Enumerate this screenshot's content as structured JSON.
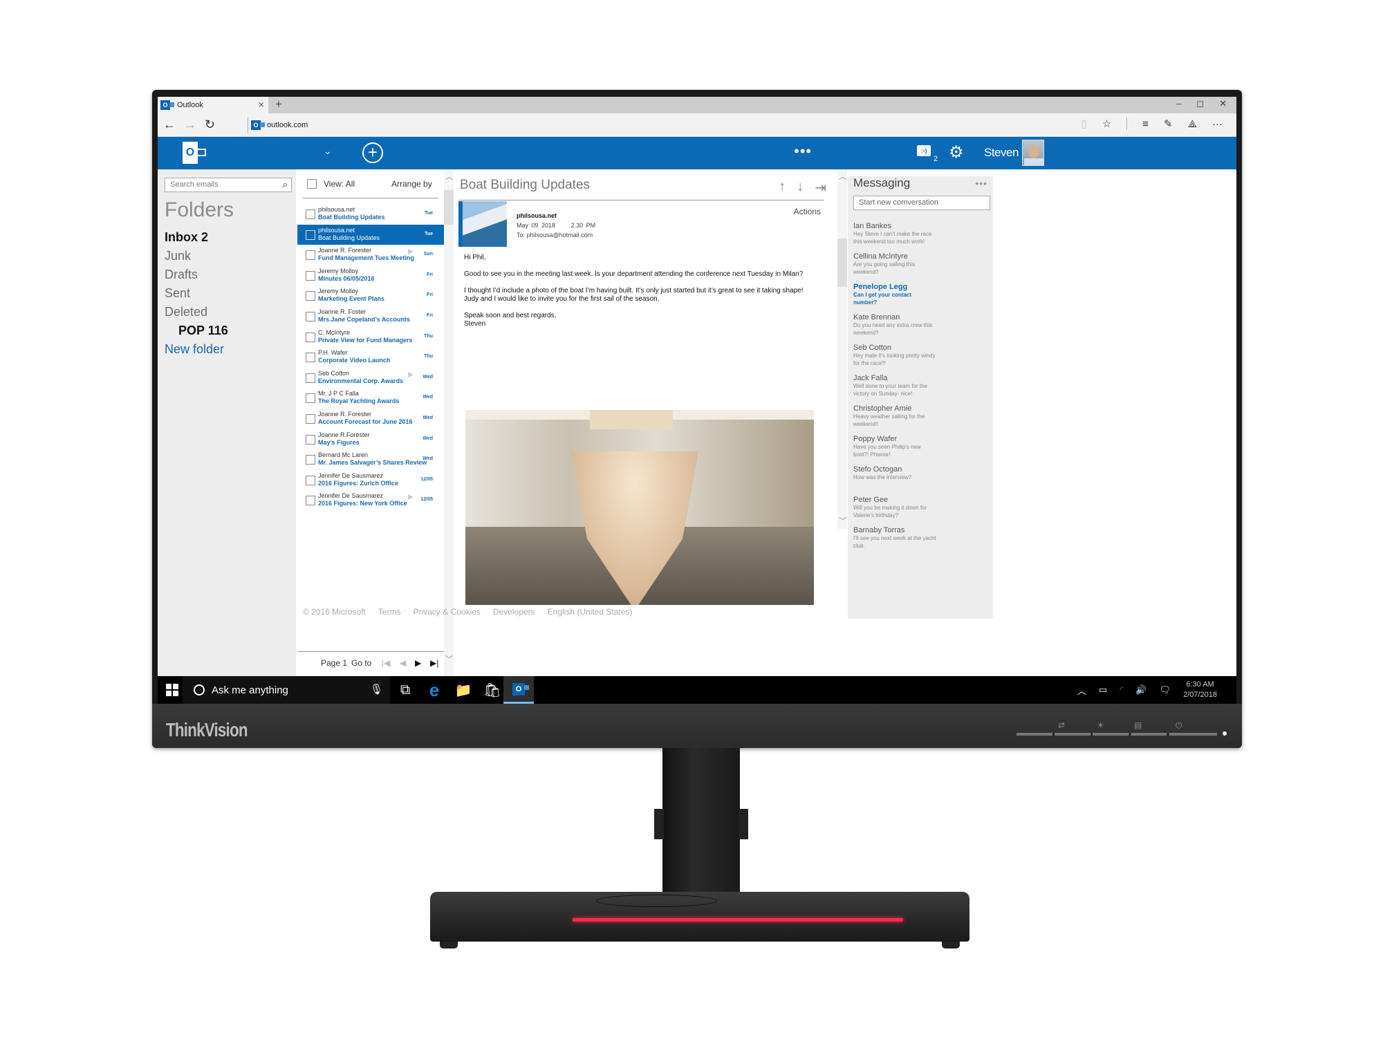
{
  "monitor": {
    "brand": "ThinkVision",
    "osd_icons": [
      "input-switch-icon",
      "brightness-icon",
      "menu-icon",
      "power-icon"
    ]
  },
  "browser": {
    "tab_title": "Outlook",
    "new_tab_symbol": "+",
    "close_symbol": "×",
    "window_controls": [
      "–",
      "◻",
      "✕"
    ],
    "nav": {
      "back": "←",
      "forward": "→",
      "refresh": "↻"
    },
    "url": "outlook.com",
    "tools": [
      "▯",
      "☆",
      "≡",
      "✎",
      "⟁",
      "···"
    ]
  },
  "appbar": {
    "logo_letter": "O",
    "dropdown": "⌄",
    "compose": "+",
    "more": "•••",
    "chat_icon_text": ":-)",
    "chat_count": "2",
    "settings": "⚙",
    "user_name": "Steven"
  },
  "folders": {
    "search_placeholder": "Search emails",
    "search_icon": "⌕",
    "title": "Folders",
    "items": [
      {
        "label": "Inbox  2"
      },
      {
        "label": "Junk"
      },
      {
        "label": "Drafts"
      },
      {
        "label": "Sent"
      },
      {
        "label": "Deleted"
      },
      {
        "label": "POP 116"
      },
      {
        "label": "New folder"
      }
    ]
  },
  "message_list": {
    "view_label": "View: All",
    "arrange_label": "Arrange by",
    "messages": [
      {
        "from": "philsousa.net",
        "subject": "Boat Building Updates",
        "date": "Tue",
        "flag": false,
        "selected": false
      },
      {
        "from": "philsousa.net",
        "subject": "Boat Building Updates",
        "date": "Tue",
        "flag": false,
        "selected": true
      },
      {
        "from": "Joanne R. Forester",
        "subject": "Fund Management Tues Meeting",
        "date": "Sun",
        "flag": true,
        "selected": false
      },
      {
        "from": "Jeremy Molloy",
        "subject": "Minutes 06/05/2016",
        "date": "Fri",
        "flag": false,
        "selected": false
      },
      {
        "from": "Jeremy Molloy",
        "subject": "Marketing Event Plans",
        "date": "Fri",
        "flag": false,
        "selected": false
      },
      {
        "from": "Joanne R. Foster",
        "subject": "Mrs.Jane Copeland’s Accounts",
        "date": "Fri",
        "flag": false,
        "selected": false
      },
      {
        "from": "C. McIntyre",
        "subject": "Private View for Fund Managers",
        "date": "Thu",
        "flag": false,
        "selected": false
      },
      {
        "from": "P.H. Wafer",
        "subject": "Corporate Video Launch",
        "date": "Thu",
        "flag": false,
        "selected": false
      },
      {
        "from": "Seb Cotton",
        "subject": "Environmental Corp. Awards",
        "date": "Wed",
        "flag": true,
        "selected": false
      },
      {
        "from": "Mr. J P C Falla",
        "subject": "The Royal Yachting Awards",
        "date": "Wed",
        "flag": false,
        "selected": false
      },
      {
        "from": "Joanne R. Forester",
        "subject": "Account Forecast for June 2016",
        "date": "Wed",
        "flag": false,
        "selected": false
      },
      {
        "from": "Joanne R.Forester",
        "subject": "May’s Figures",
        "date": "Wed",
        "flag": false,
        "selected": false
      },
      {
        "from": "Bernard Mc Laren",
        "subject": "Mr. James Salvager’s Shares Review",
        "date": "Wed",
        "flag": false,
        "selected": false
      },
      {
        "from": "Jennifer De Sausmarez",
        "subject": "2016 Figures: Zurich Office",
        "date": "12/05",
        "flag": false,
        "selected": false
      },
      {
        "from": "Jennifer De Sausmarez",
        "subject": "2016 Figures: New York Office",
        "date": "12/05",
        "flag": true,
        "selected": false
      }
    ],
    "pager": {
      "page": "Page 1",
      "goto": "Go to",
      "first": "|◀",
      "prev": "◀",
      "next": "▶",
      "last": "▶|"
    }
  },
  "footer": {
    "links": [
      "© 2016 Microsoft",
      "Terms",
      "Privacy & Cookies",
      "Developers",
      "English (United States)"
    ]
  },
  "reading": {
    "title": "Boat Building Updates",
    "tools": [
      "↑",
      "↓",
      "⇥"
    ],
    "sender": "philsousa.net",
    "date": "May 09 2018",
    "time": "2.30 PM",
    "to": "To: philsousa@hotmail.com",
    "actions": "Actions",
    "body": [
      "Hi Phil,",
      "Good to see you in the meeting last week. Is your department attending the conference next Tuesday in Milan?",
      "I thought I’d include a photo of the boat I’m having built. It’s only just started but it’s great to see it taking shape! Judy and I would like to invite you for the first sail of the season.",
      "Speak soon and best regards,\nSteven"
    ]
  },
  "messaging": {
    "title": "Messaging",
    "more": "•••",
    "new_placeholder": "Start new comversation",
    "conversations": [
      {
        "name": "Ian Bankes",
        "preview": "Hey Steve I can’t make the race this weekend too much work!",
        "highlight": false
      },
      {
        "name": "Cellina McIntyre",
        "preview": "Are you going sailing this weekend?",
        "highlight": false
      },
      {
        "name": "Penelope Legg",
        "preview": "Can I get your contact number?",
        "highlight": true
      },
      {
        "name": "Kate Brennan",
        "preview": "Do you need any extra crew this weekend?",
        "highlight": false
      },
      {
        "name": "Seb Cotton",
        "preview": "Hey mate it’s looking pretty windy for the race!!!",
        "highlight": false
      },
      {
        "name": "Jack Falla",
        "preview": "Well done to your team for the victory on Sunday- nice!",
        "highlight": false
      },
      {
        "name": "Christopher Amie",
        "preview": "Heavy weather sailing for the weekend!!",
        "highlight": false
      },
      {
        "name": "Poppy Wafer",
        "preview": "Have you seen Philip’s new boat?! Phwoar!",
        "highlight": false
      },
      {
        "name": "Stefo Octogan",
        "preview": "How was the interview?",
        "highlight": false
      },
      {
        "name": "Peter Gee",
        "preview": "Will you be making it down for Valerie’s birthday?",
        "highlight": false
      },
      {
        "name": "Barnaby Torras",
        "preview": "I’ll see you next week at the yacht club.",
        "highlight": false
      }
    ]
  },
  "taskbar": {
    "search_text": "Ask me anything",
    "mic": "🎙",
    "apps": [
      {
        "name": "task-view",
        "glyph": "⧉"
      },
      {
        "name": "edge",
        "glyph": "e"
      },
      {
        "name": "file-explorer",
        "glyph": "📁"
      },
      {
        "name": "store",
        "glyph": "🛍"
      },
      {
        "name": "outlook",
        "glyph": "O"
      }
    ],
    "tray": {
      "chevron": "︿",
      "battery": "▭",
      "wifi": "◜",
      "volume": "🔊",
      "notifications": "🗨"
    },
    "time": "6:30 AM",
    "date": "2/07/2018"
  },
  "colors": {
    "accent": "#0a6ab6",
    "link": "#1769b3",
    "taskbar": "#000000",
    "stand_light": "#ff2a4a"
  }
}
